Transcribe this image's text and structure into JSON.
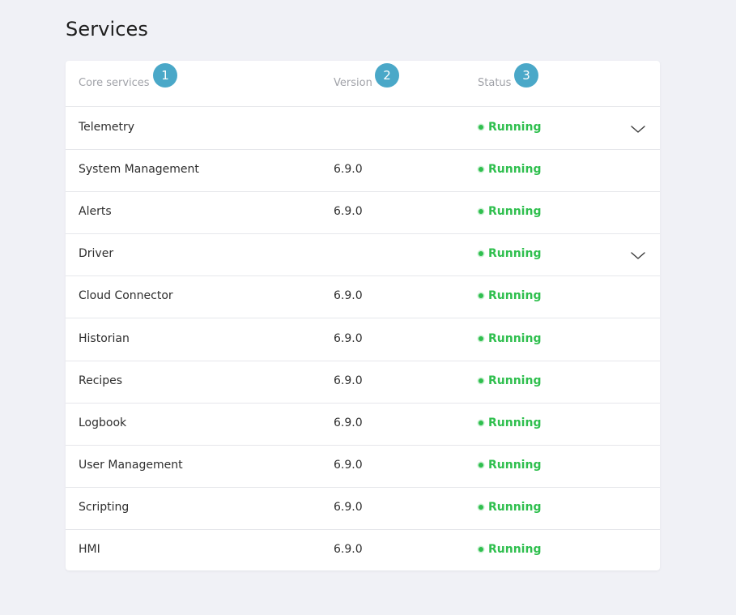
{
  "page": {
    "title": "Services"
  },
  "table": {
    "headers": {
      "name": "Core services",
      "version": "Version",
      "status": "Status"
    },
    "badges": [
      "1",
      "2",
      "3"
    ],
    "status_color": "#2fbf4e",
    "badge_color": "#4aa8c8",
    "rows": [
      {
        "name": "Telemetry",
        "version": "",
        "status": "Running",
        "expandable": true
      },
      {
        "name": "System Management",
        "version": "6.9.0",
        "status": "Running",
        "expandable": false
      },
      {
        "name": "Alerts",
        "version": "6.9.0",
        "status": "Running",
        "expandable": false
      },
      {
        "name": "Driver",
        "version": "",
        "status": "Running",
        "expandable": true
      },
      {
        "name": "Cloud Connector",
        "version": "6.9.0",
        "status": "Running",
        "expandable": false
      },
      {
        "name": "Historian",
        "version": "6.9.0",
        "status": "Running",
        "expandable": false
      },
      {
        "name": "Recipes",
        "version": "6.9.0",
        "status": "Running",
        "expandable": false
      },
      {
        "name": "Logbook",
        "version": "6.9.0",
        "status": "Running",
        "expandable": false
      },
      {
        "name": "User Management",
        "version": "6.9.0",
        "status": "Running",
        "expandable": false
      },
      {
        "name": "Scripting",
        "version": "6.9.0",
        "status": "Running",
        "expandable": false
      },
      {
        "name": "HMI",
        "version": "6.9.0",
        "status": "Running",
        "expandable": false
      }
    ]
  }
}
